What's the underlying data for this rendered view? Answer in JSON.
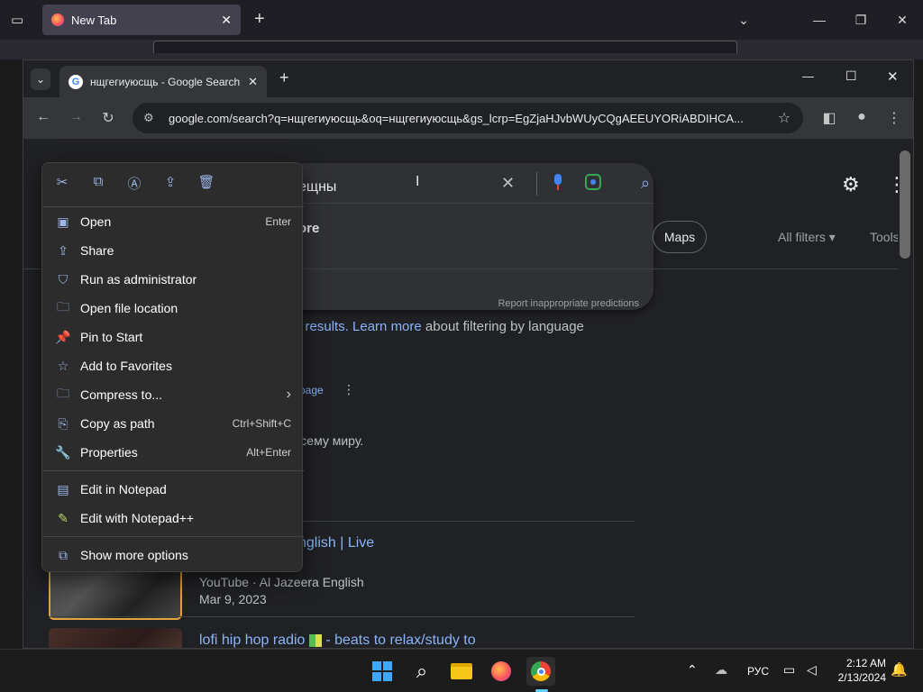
{
  "firefox": {
    "tab_title": "New Tab",
    "close_symbol": "✕",
    "newtab_symbol": "+",
    "chevron": "⌄",
    "minimize": "—",
    "maximize": "❐",
    "close": "✕"
  },
  "chrome": {
    "tab_title": "нщгегиуюсщь - Google Search",
    "tab_close": "✕",
    "newtab": "+",
    "tab_search": "⌄",
    "minimize": "—",
    "maximize": "☐",
    "close": "✕",
    "back": "←",
    "forward": "→",
    "reload": "↻",
    "url": "google.com/search?q=нщгегиуюсщь&oq=нщгегиуюсщь&gs_lcrp=EgZjaHJvbWUyCQgAEEUYORiABDIHCA...",
    "bookmark": "☆",
    "sidepanel": "◧",
    "profile": "●",
    "menu": "⋮"
  },
  "page": {
    "search_value": "ещны",
    "clear_symbol": "✕",
    "suggestion_fragment": "ore",
    "report": "Report inappropriate predictions",
    "maps": "Maps",
    "all_filters": "All filters ▾",
    "tools": "Tools",
    "filter_prefix": "e results.",
    "filter_link": "Learn more",
    "filter_suffix": "about filtering by language",
    "page_link": "page",
    "page_kebab": "⋮",
    "mir": "всему миру.",
    "eng_live": "nglish | Live",
    "yt_source": "YouTube · Al Jazeera English",
    "yt_date": "Mar 9, 2023",
    "lofi_a": "lofi hip hop radio",
    "lofi_b": "- beats to relax/study to"
  },
  "context_menu": {
    "top_icons": [
      "cut-icon",
      "copy-icon",
      "rename-icon",
      "share-icon",
      "delete-icon"
    ],
    "top_glyphs": [
      "✂",
      "⧉",
      "Ⓐ",
      "⇪",
      "🗑"
    ],
    "items": [
      {
        "label": "Open",
        "shortcut": "Enter",
        "glyph": "▣"
      },
      {
        "label": "Share",
        "shortcut": "",
        "glyph": "⇪"
      },
      {
        "label": "Run as administrator",
        "shortcut": "",
        "glyph": "⛉"
      },
      {
        "label": "Open file location",
        "shortcut": "",
        "glyph": "🗀"
      },
      {
        "label": "Pin to Start",
        "shortcut": "",
        "glyph": "📌"
      },
      {
        "label": "Add to Favorites",
        "shortcut": "",
        "glyph": "☆"
      },
      {
        "label": "Compress to...",
        "shortcut": "›",
        "glyph": "🗀"
      },
      {
        "label": "Copy as path",
        "shortcut": "Ctrl+Shift+C",
        "glyph": "⎘"
      },
      {
        "label": "Properties",
        "shortcut": "Alt+Enter",
        "glyph": "🔧"
      },
      {
        "label": "Edit in Notepad",
        "shortcut": "",
        "glyph": "▤"
      },
      {
        "label": "Edit with Notepad++",
        "shortcut": "",
        "glyph": "✎"
      },
      {
        "label": "Show more options",
        "shortcut": "",
        "glyph": "⧉"
      }
    ]
  },
  "taskbar": {
    "start": "⊞",
    "search": "⌕",
    "explorer": "🗀",
    "firefox": "◉",
    "chrome": "◎",
    "tray_up": "⌃",
    "lang": "РУС",
    "time": "2:12 AM",
    "date": "2/13/2024",
    "bell": "🔔"
  }
}
